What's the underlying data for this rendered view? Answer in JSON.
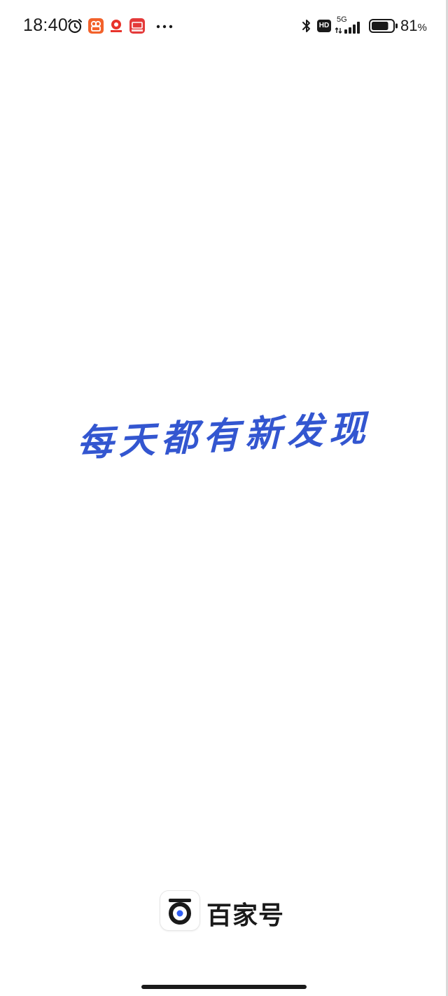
{
  "status_bar": {
    "time": "18:40",
    "net_type": "5G",
    "hd_label": "HD",
    "battery_percent": "81",
    "battery_unit": "%",
    "battery_level": 0.81
  },
  "splash": {
    "slogan": "每天都有新发现"
  },
  "brand": {
    "name": "百家号"
  },
  "colors": {
    "slogan": "#3356d0",
    "brand_icon_accent": "#2f5ef4",
    "text": "#1a1a1a"
  },
  "icons": {
    "status_left": [
      "alarm-icon",
      "app-notification-icon",
      "app-notification-icon",
      "app-notification-icon",
      "more-notifications-icon"
    ],
    "status_right": [
      "bluetooth-icon",
      "hd-icon",
      "signal-icon",
      "battery-icon"
    ]
  }
}
